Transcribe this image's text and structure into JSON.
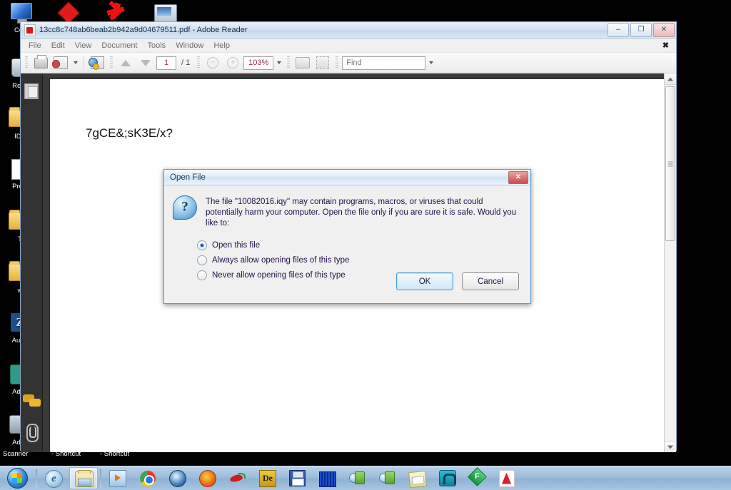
{
  "desktop": {
    "icons": [
      {
        "label": "Com",
        "icon": "computer-icon"
      },
      {
        "label": "",
        "icon": "red-diamond-icon"
      },
      {
        "label": "",
        "icon": "red-splat-icon"
      },
      {
        "label": "",
        "icon": "scanner-icon"
      },
      {
        "label": "Recy",
        "icon": "recycle-bin-icon"
      },
      {
        "label": "IDA",
        "icon": "folder-icon"
      },
      {
        "label": "Proci",
        "icon": "procmon-icon"
      },
      {
        "label": "T",
        "icon": "folder-icon"
      },
      {
        "label": "w",
        "icon": "folder-icon"
      },
      {
        "label": "Autor",
        "icon": "autoruns-icon"
      },
      {
        "label": "Admi",
        "icon": "key-icon"
      },
      {
        "label": "Adva",
        "icon": "camera-icon"
      }
    ],
    "bottom_labels": [
      "Scanner",
      "- Shortcut",
      "- Shortcut"
    ],
    "overlay_icons": [
      "speech-bubbles-icon",
      "paperclip-icon"
    ]
  },
  "reader": {
    "title": "13cc8c748ab6beab2b942a9d04679511.pdf - Adobe Reader",
    "window_buttons": {
      "minimize": "–",
      "restore": "❐",
      "close": "✕"
    },
    "menu": [
      "File",
      "Edit",
      "View",
      "Document",
      "Tools",
      "Window",
      "Help"
    ],
    "document_close": "✖",
    "toolbar": {
      "print": "print-icon",
      "email": "email-icon",
      "collaborate": "collaborate-icon",
      "prev_page": "arrow-up-icon",
      "next_page": "arrow-down-icon",
      "page_value": "1",
      "page_total": "/ 1",
      "zoom_out": "−",
      "zoom_in": "+",
      "zoom_value": "103%",
      "fit_width": "fit-width-icon",
      "fit_page": "fit-page-icon",
      "find_placeholder": "Find",
      "find_value": "Find"
    },
    "sidebar": {
      "pages_icon": "pages-panel-icon"
    },
    "page_text": "7gCE&;sK3E/x?"
  },
  "dialog": {
    "title": "Open File",
    "close": "✕",
    "icon": "question-mark-icon",
    "message": "The file \"10082016.iqy\" may contain programs, macros, or viruses that could potentially harm your computer. Open the file only if you are sure it is safe. Would you like to:",
    "options": [
      {
        "label": "Open this file",
        "selected": true
      },
      {
        "label": "Always allow opening files of this type",
        "selected": false
      },
      {
        "label": "Never allow opening files of this type",
        "selected": false
      }
    ],
    "ok": "OK",
    "cancel": "Cancel"
  },
  "taskbar": {
    "start": "start-orb",
    "items": [
      {
        "name": "internet-explorer",
        "label": ""
      },
      {
        "name": "windows-explorer",
        "label": "",
        "active": true
      },
      {
        "name": "windows-media-player",
        "label": ""
      },
      {
        "name": "google-chrome",
        "label": ""
      },
      {
        "name": "thunderbird",
        "label": ""
      },
      {
        "name": "firefox",
        "label": ""
      },
      {
        "name": "chili-app",
        "label": ""
      },
      {
        "name": "de-app",
        "label": ""
      },
      {
        "name": "floppy-save-app",
        "label": ""
      },
      {
        "name": "database-app",
        "label": ""
      },
      {
        "name": "windows-app-1",
        "label": ""
      },
      {
        "name": "windows-app-2",
        "label": ""
      },
      {
        "name": "notepad-app",
        "label": ""
      },
      {
        "name": "n-app",
        "label": ""
      },
      {
        "name": "f-app",
        "label": ""
      },
      {
        "name": "adobe-reader",
        "label": ""
      }
    ]
  },
  "colors": {
    "accent": "#5b9bd0",
    "danger": "#cc4b4b",
    "desktop_bg": "#000000",
    "taskbar": "#9dbcda"
  }
}
